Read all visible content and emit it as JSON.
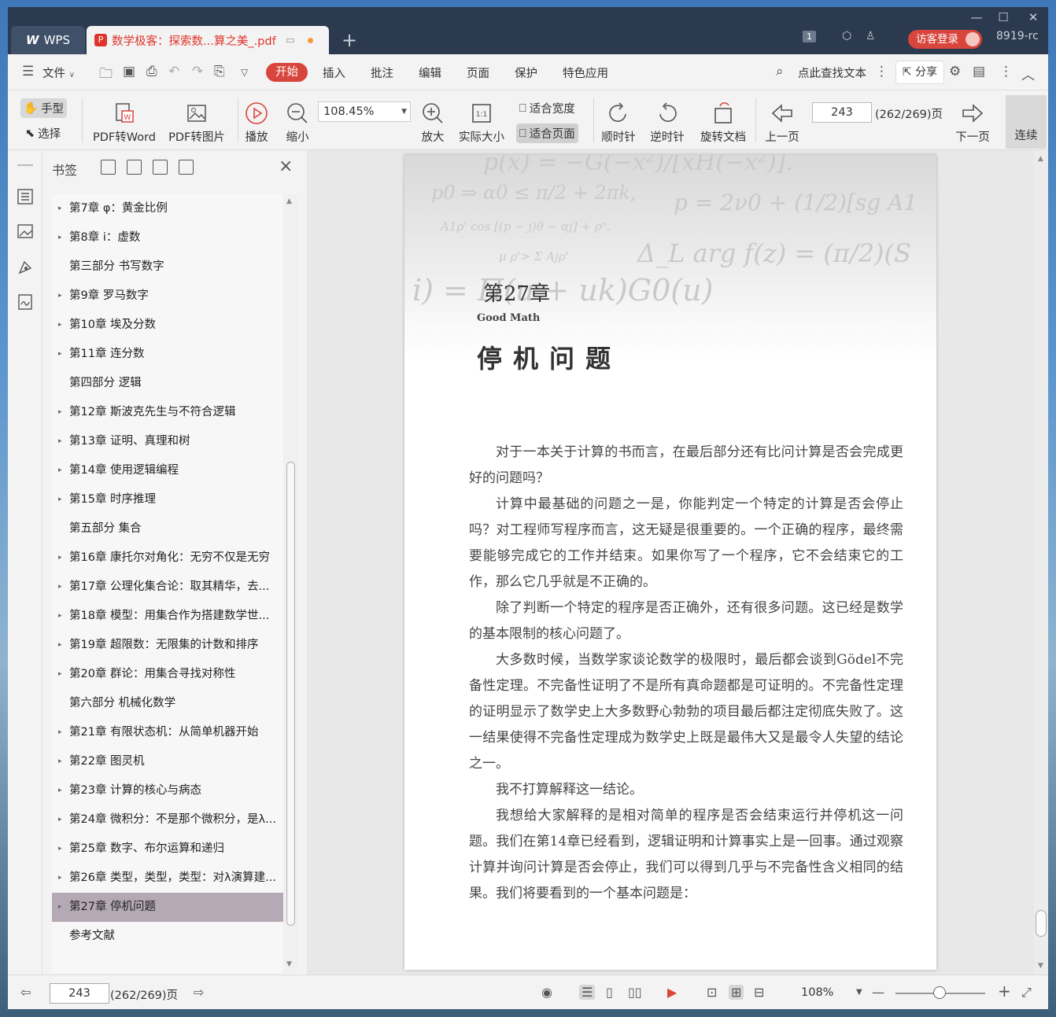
{
  "titlebar": {
    "app_tab": "WPS",
    "doc_tab": "数学极客：探索数...算之美_.pdf",
    "badge_count": "1",
    "login_label": "访客登录",
    "user_id": "8919-rc"
  },
  "menubar": {
    "file_label": "文件",
    "items": [
      "开始",
      "插入",
      "批注",
      "编辑",
      "页面",
      "保护",
      "特色应用"
    ],
    "search_label": "点此查找文本",
    "share_label": "分享"
  },
  "toolbar": {
    "hand_label": "手型",
    "select_label": "选择",
    "pdf_to_word": "PDF转Word",
    "pdf_to_image": "PDF转图片",
    "play_label": "播放",
    "zoom_out_label": "缩小",
    "zoom_value": "108.45%",
    "zoom_in_label": "放大",
    "actual_size_label": "实际大小",
    "fit_width_label": "适合宽度",
    "fit_page_label": "适合页面",
    "clockwise_label": "顺时针",
    "counter_clockwise_label": "逆时针",
    "rotate_doc_label": "旋转文档",
    "prev_page_label": "上一页",
    "current_page": "243",
    "page_total": "(262/269)页",
    "next_page_label": "下一页",
    "continuous_label": "连续"
  },
  "bookmarks": {
    "title": "书签",
    "items": [
      {
        "label": "第7章 φ：黄金比例",
        "expandable": true
      },
      {
        "label": "第8章 i：虚数",
        "expandable": true
      },
      {
        "label": "第三部分 书写数字",
        "expandable": false
      },
      {
        "label": "第9章 罗马数字",
        "expandable": true
      },
      {
        "label": "第10章 埃及分数",
        "expandable": true
      },
      {
        "label": "第11章 连分数",
        "expandable": true
      },
      {
        "label": "第四部分 逻辑",
        "expandable": false
      },
      {
        "label": "第12章 斯波克先生与不符合逻辑",
        "expandable": true
      },
      {
        "label": "第13章 证明、真理和树",
        "expandable": true
      },
      {
        "label": "第14章 使用逻辑编程",
        "expandable": true
      },
      {
        "label": "第15章 时序推理",
        "expandable": true
      },
      {
        "label": "第五部分 集合",
        "expandable": false
      },
      {
        "label": "第16章 康托尔对角化：无穷不仅是无穷",
        "expandable": true
      },
      {
        "label": "第17章 公理化集合论：取其精华，去...",
        "expandable": true
      },
      {
        "label": "第18章 模型：用集合作为搭建数学世...",
        "expandable": true
      },
      {
        "label": "第19章 超限数：无限集的计数和排序",
        "expandable": true
      },
      {
        "label": "第20章 群论：用集合寻找对称性",
        "expandable": true
      },
      {
        "label": "第六部分 机械化数学",
        "expandable": false
      },
      {
        "label": "第21章 有限状态机：从简单机器开始",
        "expandable": true
      },
      {
        "label": "第22章 图灵机",
        "expandable": true
      },
      {
        "label": "第23章 计算的核心与病态",
        "expandable": true
      },
      {
        "label": "第24章 微积分：不是那个微积分，是λ...",
        "expandable": true
      },
      {
        "label": "第25章 数字、布尔运算和递归",
        "expandable": true
      },
      {
        "label": "第26章 类型，类型，类型：对λ演算建...",
        "expandable": true
      },
      {
        "label": "第27章 停机问题",
        "expandable": true,
        "active": true
      },
      {
        "label": "参考文献",
        "expandable": false
      }
    ]
  },
  "document": {
    "formula_1": "p(x) = −G(−x²)/[xH(−x²)].",
    "formula_2": "p0 ⇒ α0 ≤ π/2 + 2πk,",
    "formula_3": "p = 2ν0 + (1/2)[sg A1",
    "formula_4": "A1ρ' cos [(p − j)θ − αj] + ρⁿ.",
    "formula_5": "Δ_L arg f(z) = (π/2)(S",
    "formula_6": "μ   ρ'> Σ Ajρ'",
    "formula_7": "i) = Π(u + uk)G0(u)",
    "chapter_no": "第27章",
    "series": "Good Math",
    "chapter_title": "停机问题",
    "paragraphs": [
      "对于一本关于计算的书而言，在最后部分还有比问计算是否会完成更好的问题吗？",
      "计算中最基础的问题之一是，你能判定一个特定的计算是否会停止吗？对工程师写程序而言，这无疑是很重要的。一个正确的程序，最终需要能够完成它的工作并结束。如果你写了一个程序，它不会结束它的工作，那么它几乎就是不正确的。",
      "除了判断一个特定的程序是否正确外，还有很多问题。这已经是数学的基本限制的核心问题了。",
      "大多数时候，当数学家谈论数学的极限时，最后都会谈到Gödel不完备性定理。不完备性证明了不是所有真命题都是可证明的。不完备性定理的证明显示了数学史上大多数野心勃勃的项目最后都注定彻底失败了。这一结果使得不完备性定理成为数学史上既是最伟大又是最令人失望的结论之一。",
      "我不打算解释这一结论。",
      "我想给大家解释的是相对简单的程序是否会结束运行并停机这一问题。我们在第14章已经看到，逻辑证明和计算事实上是一回事。通过观察计算并询问计算是否会停止，我们可以得到几乎与不完备性含义相同的结果。我们将要看到的一个基本问题是："
    ]
  },
  "statusbar": {
    "current_page": "243",
    "page_total": "(262/269)页",
    "zoom": "108%"
  }
}
